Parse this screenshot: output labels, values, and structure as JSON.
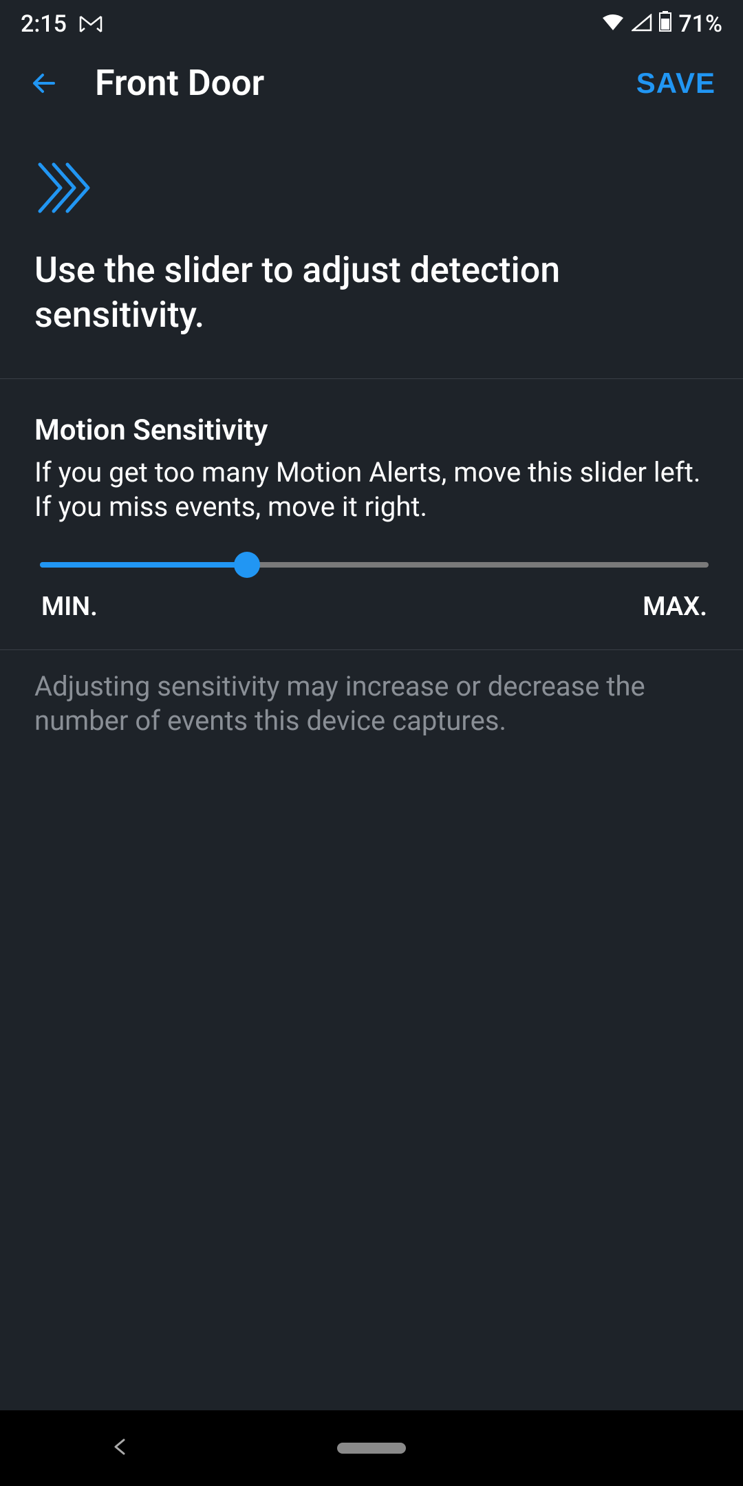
{
  "statusBar": {
    "time": "2:15",
    "battery": "71%"
  },
  "header": {
    "title": "Front Door",
    "saveLabel": "SAVE"
  },
  "intro": {
    "text": "Use the slider to adjust detection sensitivity."
  },
  "sensitivity": {
    "title": "Motion Sensitivity",
    "description": "If you get too many Motion Alerts, move this slider left. If you miss events, move it right.",
    "minLabel": "MIN.",
    "maxLabel": "MAX.",
    "valuePercent": 31
  },
  "footerNote": "Adjusting sensitivity may increase or decrease the number of events this device captures.",
  "colors": {
    "accent": "#2196f3",
    "background": "#1e2329",
    "textPrimary": "#ffffff",
    "textSecondary": "#8a8f96"
  }
}
